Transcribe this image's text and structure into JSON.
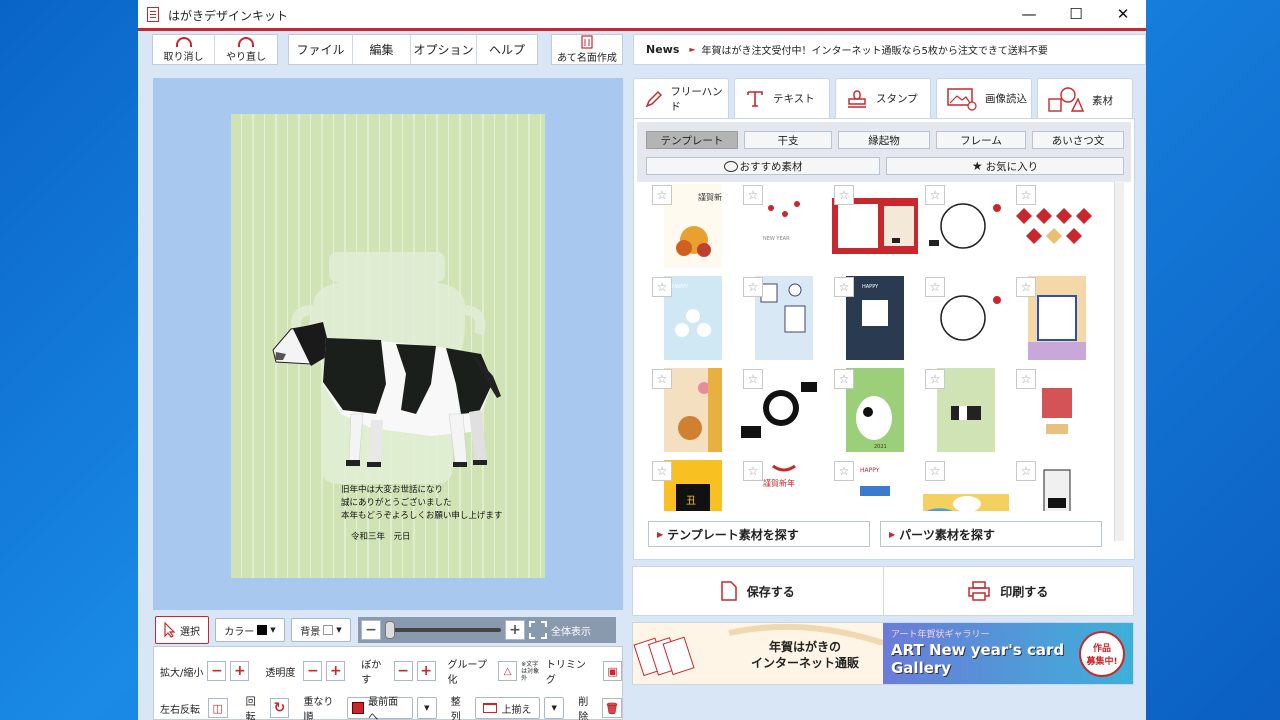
{
  "window": {
    "title": "はがきデザインキット"
  },
  "toolbar": {
    "undo": "取り消し",
    "redo": "やり直し",
    "menus": [
      "ファイル",
      "編集",
      "オプション",
      "ヘルプ"
    ],
    "address": "あて名面作成"
  },
  "news": {
    "label": "News",
    "text": "年賀はがき注文受付中！インターネット通販なら5枚から注文できて送料不要"
  },
  "card": {
    "lines": [
      "旧年中は大変お世話になり",
      "誠にありがとうございました",
      "本年もどうぞよろしくお願い申し上げます"
    ],
    "date": "令和三年　元日"
  },
  "tools": {
    "select": "選択",
    "color": "カラー",
    "background": "背景",
    "fit": "全体表示",
    "zoom": "拡大/縮小",
    "opacity": "透明度",
    "blur": "ぼかす",
    "group": "グループ化",
    "group_note": "※文字は対象外",
    "trim": "トリミング",
    "flip": "左右反転",
    "rotate": "回転",
    "order": "重なり順",
    "order_value": "最前面へ",
    "align": "整列",
    "align_value": "上揃え",
    "delete": "削除"
  },
  "tabs": [
    "フリーハンド",
    "テキスト",
    "スタンプ",
    "画像読込",
    "素材"
  ],
  "categories": [
    "テンプレート",
    "干支",
    "縁起物",
    "フレーム",
    "あいさつ文"
  ],
  "special": [
    "おすすめ素材",
    "お気に入り"
  ],
  "find": {
    "template": "テンプレート素材を探す",
    "parts": "パーツ素材を探す"
  },
  "actions": {
    "save": "保存する",
    "print": "印刷する"
  },
  "banner": {
    "left_line1": "年賀はがきの",
    "left_line2": "インターネット通販",
    "right_small": "アート年賀状ギャラリー",
    "right_title1": "ART New year's card",
    "right_title2": "Gallery",
    "badge1": "作品",
    "badge2": "募集中!"
  },
  "thumb_text": {
    "happy": "HAPPY",
    "newyear": "NEW YEAR",
    "kinga": "謹賀新年",
    "year": "2021",
    "ushi": "丑"
  },
  "colors": {
    "accent": "#c8282d",
    "card_bg": "#cfe3b5",
    "canvas_bg": "#a8c8f0"
  }
}
